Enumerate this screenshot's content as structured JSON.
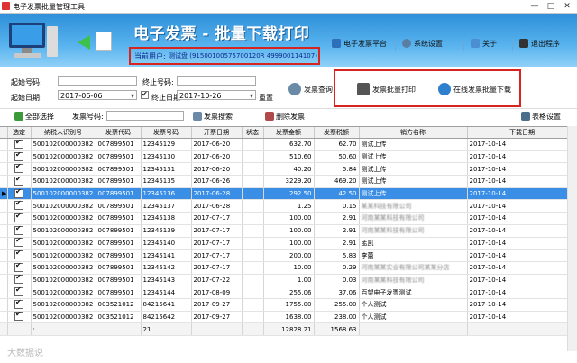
{
  "window": {
    "title": "电子发票批量管理工具",
    "min": "—",
    "max": "□",
    "close": "✕"
  },
  "banner": {
    "title": "电子发票 - 批量下载打印",
    "user_label": "当前用户:",
    "user_name": "测试盘",
    "user_id": "(91500100575700120R 499900114107)",
    "buttons": [
      "电子发票平台",
      "系统设置",
      "关于",
      "退出程序"
    ]
  },
  "filters": {
    "start_no_label": "起始号码:",
    "end_no_label": "终止号码:",
    "start_date_label": "起始日期:",
    "end_date_label": "终止日期:",
    "start_date": "2017-06-06",
    "end_date": "2017-10-26",
    "reset_label": "重置",
    "query_label": "发票查询",
    "batch_print_label": "发票批量打印",
    "online_download_label": "在线发票批量下载"
  },
  "toolbar": {
    "select_all": "全部选择",
    "invoice_no_label": "发票号码:",
    "search": "发票搜索",
    "delete": "删除发票",
    "grid_settings": "表格设置"
  },
  "table": {
    "columns": [
      "选定",
      "纳税人识别号",
      "发票代码",
      "发票号码",
      "开票日期",
      "状态",
      "发票金额",
      "发票税额",
      "销方名称",
      "下载日期"
    ],
    "rows": [
      [
        "500102000000382",
        "007899501",
        "12345129",
        "2017-06-20",
        "",
        "632.70",
        "62.70",
        "测试上传",
        "2017-10-14"
      ],
      [
        "500102000000382",
        "007899501",
        "12345130",
        "2017-06-20",
        "",
        "510.60",
        "50.60",
        "测试上传",
        "2017-10-14"
      ],
      [
        "500102000000382",
        "007899501",
        "12345131",
        "2017-06-20",
        "",
        "40.20",
        "5.84",
        "测试上传",
        "2017-10-14"
      ],
      [
        "500102000000382",
        "007899501",
        "12345135",
        "2017-06-26",
        "",
        "3229.20",
        "469.20",
        "测试上传",
        "2017-10-14"
      ],
      [
        "500102000000382",
        "007899501",
        "12345136",
        "2017-06-28",
        "",
        "292.50",
        "42.50",
        "测试上传",
        "2017-10-14"
      ],
      [
        "500102000000382",
        "007899501",
        "12345137",
        "2017-06-28",
        "",
        "1.25",
        "0.15",
        "某某科技有限公司",
        "2017-10-14"
      ],
      [
        "500102000000382",
        "007899501",
        "12345138",
        "2017-07-17",
        "",
        "100.00",
        "2.91",
        "河南某某科技有限公司",
        "2017-10-14"
      ],
      [
        "500102000000382",
        "007899501",
        "12345139",
        "2017-07-17",
        "",
        "100.00",
        "2.91",
        "河南某某科技有限公司",
        "2017-10-14"
      ],
      [
        "500102000000382",
        "007899501",
        "12345140",
        "2017-07-17",
        "",
        "100.00",
        "2.91",
        "孟凯",
        "2017-10-14"
      ],
      [
        "500102000000382",
        "007899501",
        "12345141",
        "2017-07-17",
        "",
        "200.00",
        "5.83",
        "李蕾",
        "2017-10-14"
      ],
      [
        "500102000000382",
        "007899501",
        "12345142",
        "2017-07-17",
        "",
        "10.00",
        "0.29",
        "河南某某实业有限公司某某分店",
        "2017-10-14"
      ],
      [
        "500102000000382",
        "007899501",
        "12345143",
        "2017-07-22",
        "",
        "1.00",
        "0.03",
        "河南某某科技有限公司",
        "2017-10-14"
      ],
      [
        "500102000000382",
        "007899501",
        "12345144",
        "2017-08-09",
        "",
        "255.06",
        "37.06",
        "百望电子发票测试",
        "2017-10-14"
      ],
      [
        "500102000000382",
        "003521012",
        "84215641",
        "2017-09-27",
        "",
        "1755.00",
        "255.00",
        "个人测试",
        "2017-10-14"
      ],
      [
        "500102000000382",
        "003521012",
        "84215642",
        "2017-09-27",
        "",
        "1638.00",
        "238.00",
        "个人测试",
        "2017-10-14"
      ]
    ],
    "selected_row": 4,
    "summary": {
      "label": ":",
      "count": "21",
      "amount": "12828.21",
      "tax": "1568.63"
    }
  },
  "watermark": "大数据说"
}
